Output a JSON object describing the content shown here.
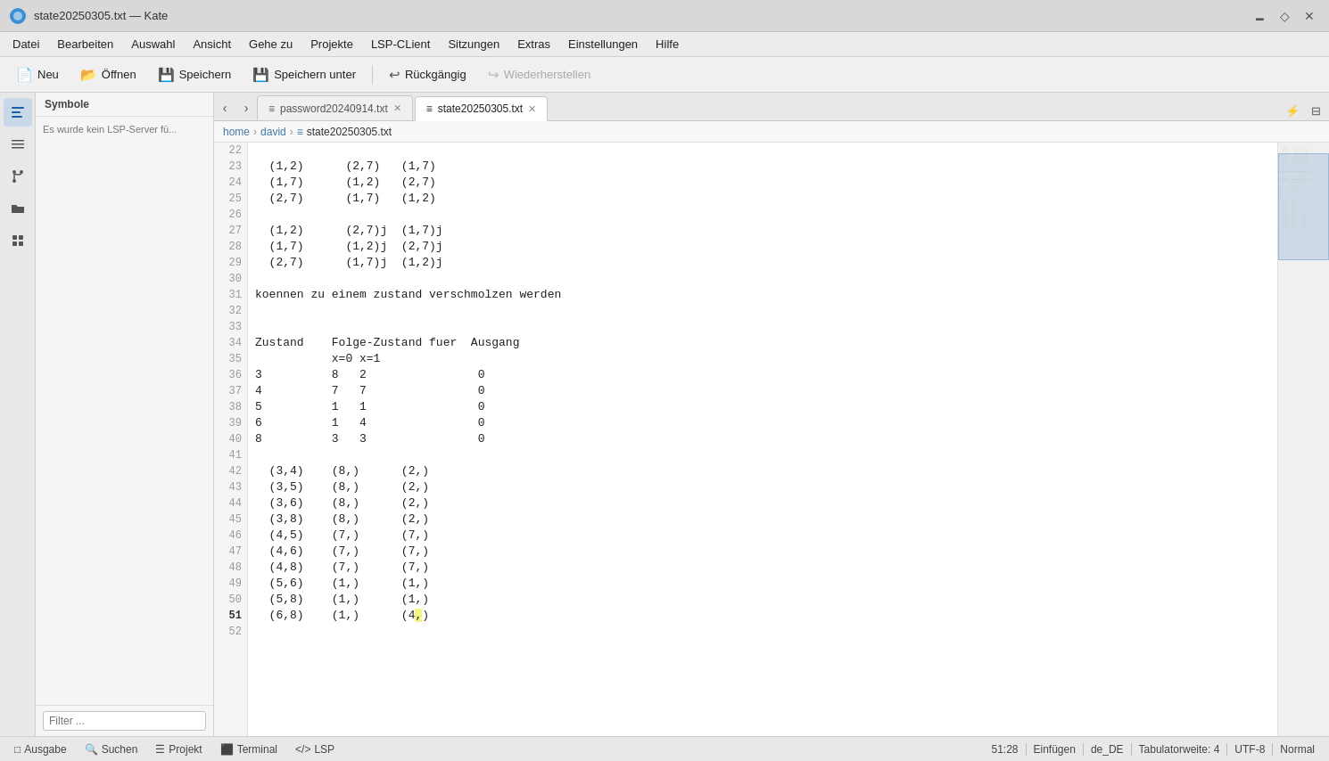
{
  "window": {
    "title": "state20250305.txt — Kate",
    "app_icon": "🔵"
  },
  "title_controls": {
    "minimize": "🗕",
    "restore": "◇",
    "close": "✕"
  },
  "menu": {
    "items": [
      "Datei",
      "Bearbeiten",
      "Auswahl",
      "Ansicht",
      "Gehe zu",
      "Projekte",
      "LSP-CLient",
      "Sitzungen",
      "Extras",
      "Einstellungen",
      "Hilfe"
    ]
  },
  "toolbar": {
    "new_label": "Neu",
    "open_label": "Öffnen",
    "save_label": "Speichern",
    "save_as_label": "Speichern unter",
    "undo_label": "Rückgängig",
    "redo_label": "Wiederherstellen"
  },
  "sidebar": {
    "title": "Symbole",
    "message": "Es wurde kein LSP-Server fü...",
    "filter_placeholder": "Filter ..."
  },
  "breadcrumb": {
    "parts": [
      "home",
      "david",
      "state20250305.txt"
    ]
  },
  "tabs": [
    {
      "label": "password20240914.txt",
      "active": false
    },
    {
      "label": "state20250305.txt",
      "active": true
    }
  ],
  "code": {
    "lines": [
      {
        "num": 22,
        "text": ""
      },
      {
        "num": 23,
        "text": "  (1,2)      (2,7)   (1,7)"
      },
      {
        "num": 24,
        "text": "  (1,7)      (1,2)   (2,7)"
      },
      {
        "num": 25,
        "text": "  (2,7)      (1,7)   (1,2)"
      },
      {
        "num": 26,
        "text": ""
      },
      {
        "num": 27,
        "text": "  (1,2)      (2,7)j  (1,7)j"
      },
      {
        "num": 28,
        "text": "  (1,7)      (1,2)j  (2,7)j"
      },
      {
        "num": 29,
        "text": "  (2,7)      (1,7)j  (1,2)j"
      },
      {
        "num": 30,
        "text": ""
      },
      {
        "num": 31,
        "text": "koennen zu einem zustand verschmolzen werden"
      },
      {
        "num": 32,
        "text": ""
      },
      {
        "num": 33,
        "text": ""
      },
      {
        "num": 34,
        "text": "Zustand    Folge-Zustand fuer  Ausgang"
      },
      {
        "num": 35,
        "text": "           x=0 x=1"
      },
      {
        "num": 36,
        "text": "3          8   2                0"
      },
      {
        "num": 37,
        "text": "4          7   7                0"
      },
      {
        "num": 38,
        "text": "5          1   1                0"
      },
      {
        "num": 39,
        "text": "6          1   4                0"
      },
      {
        "num": 40,
        "text": "8          3   3                0"
      },
      {
        "num": 41,
        "text": ""
      },
      {
        "num": 42,
        "text": "  (3,4)    (8,)      (2,)"
      },
      {
        "num": 43,
        "text": "  (3,5)    (8,)      (2,)"
      },
      {
        "num": 44,
        "text": "  (3,6)    (8,)      (2,)"
      },
      {
        "num": 45,
        "text": "  (3,8)    (8,)      (2,)"
      },
      {
        "num": 46,
        "text": "  (4,5)    (7,)      (7,)"
      },
      {
        "num": 47,
        "text": "  (4,6)    (7,)      (7,)"
      },
      {
        "num": 48,
        "text": "  (4,8)    (7,)      (7,)"
      },
      {
        "num": 49,
        "text": "  (5,6)    (1,)      (1,)"
      },
      {
        "num": 50,
        "text": "  (5,8)    (1,)      (1,)"
      },
      {
        "num": 51,
        "text": "  (6,8)    (1,)      (4,)",
        "cursor_at": "(4,"
      },
      {
        "num": 52,
        "text": ""
      }
    ]
  },
  "status_bar": {
    "output_label": "Ausgabe",
    "search_label": "Suchen",
    "project_label": "Projekt",
    "terminal_label": "Terminal",
    "lsp_label": "LSP",
    "cursor_pos": "51:28",
    "insert_mode": "Einfügen",
    "locale": "de_DE",
    "tab_width": "Tabulatorweite: 4",
    "encoding": "UTF-8",
    "mode": "Normal"
  }
}
